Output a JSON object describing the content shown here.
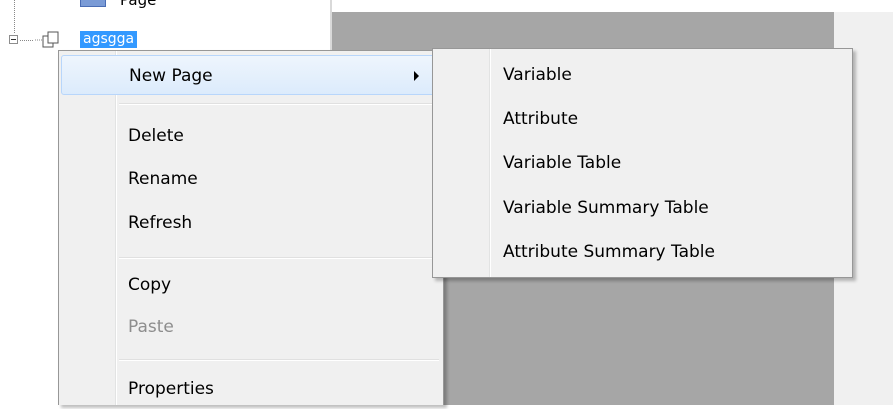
{
  "tree": {
    "top_label": "Page",
    "node_label": "agsgga"
  },
  "context_menu": {
    "items": [
      {
        "label": "New Page",
        "has_submenu": true,
        "highlighted": true
      },
      {
        "label": "Delete"
      },
      {
        "label": "Rename"
      },
      {
        "label": "Refresh"
      },
      {
        "label": "Copy"
      },
      {
        "label": "Paste",
        "disabled": true
      },
      {
        "label": "Properties"
      }
    ]
  },
  "submenu": {
    "items": [
      {
        "label": "Variable"
      },
      {
        "label": "Attribute"
      },
      {
        "label": "Variable Table"
      },
      {
        "label": "Variable Summary Table"
      },
      {
        "label": "Attribute Summary Table"
      }
    ]
  },
  "colors": {
    "selection": "#3399ff",
    "menu_bg": "#f0f0f0",
    "panel_gray": "#a6a6a6"
  }
}
